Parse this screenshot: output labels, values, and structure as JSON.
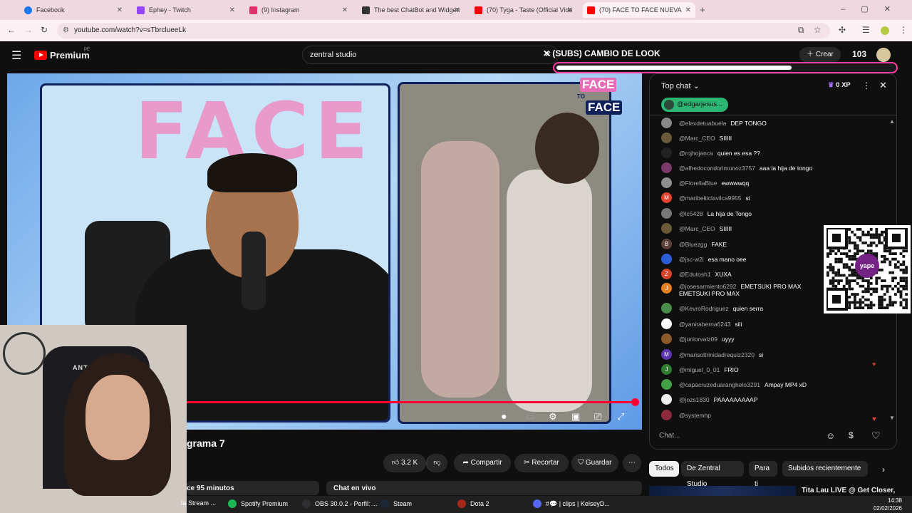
{
  "browser": {
    "tabs": [
      {
        "title": "Facebook",
        "color": "#1877f2"
      },
      {
        "title": "Ephey - Twitch",
        "color": "#9146ff"
      },
      {
        "title": "(9) Instagram",
        "color": "#e1306c"
      },
      {
        "title": "The best ChatBot and Widgets",
        "color": "#333333"
      },
      {
        "title": "(70) Tyga - Taste (Official Video)",
        "color": "#ff0000"
      },
      {
        "title": "(70) FACE TO FACE NUEVA",
        "color": "#ff0000"
      }
    ],
    "url": "youtube.com/watch?v=sTbrclueeLk"
  },
  "youtube": {
    "logo_text": "Premium",
    "logo_region": "PE",
    "search_value": "zentral studio",
    "create_label": "Crear",
    "notifications_count": "103"
  },
  "overlay": {
    "subs_title": "(SUBS) CAMBIO DE LOOK",
    "subs_progress": 0.69
  },
  "video": {
    "watermark_text": "FACE",
    "logo_top": "FACE",
    "logo_to": "TO",
    "logo_bottom": "FACE",
    "progress": 1.0,
    "title_partial": "grama 7",
    "webcam_brand": "ANTRYX"
  },
  "actions": {
    "likes": "3.2 K",
    "share": "Compartir",
    "clip": "Recortar",
    "save": "Guardar"
  },
  "below": {
    "desc_partial": "ce 95 minutos",
    "livechat_label": "Chat en vivo"
  },
  "chat": {
    "header": "Top chat",
    "xp": "0 XP",
    "pinned_user": "@edgarjesus...",
    "input_placeholder": "Chat...",
    "messages": [
      {
        "author": "@elexdetuabuela",
        "text": "DEP TONGO",
        "avatar": "#888888",
        "initial": ""
      },
      {
        "author": "@Marc_CEO",
        "text": "SIIIII",
        "avatar": "#6b5a3a",
        "initial": ""
      },
      {
        "author": "@rojhojanca",
        "text": "quien es esa ??",
        "avatar": "#222222",
        "initial": ""
      },
      {
        "author": "@alfredocondorimunoz3757",
        "text": "aaa la hija de tongo",
        "avatar": "#7a3a6a",
        "initial": ""
      },
      {
        "author": "@FiorellaBlue",
        "text": "ewwwwqq",
        "avatar": "#8e8e8e",
        "initial": ""
      },
      {
        "author": "@maribelticlavilca9955",
        "text": "si",
        "avatar": "#e0442c",
        "initial": "M"
      },
      {
        "author": "@lc5428",
        "text": "La hija de Tongo",
        "avatar": "#777777",
        "initial": ""
      },
      {
        "author": "@Marc_CEO",
        "text": "SIIIII",
        "avatar": "#6b5a3a",
        "initial": ""
      },
      {
        "author": "@Bluezgg",
        "text": "FAKE",
        "avatar": "#5d4037",
        "initial": "B"
      },
      {
        "author": "@jsc-w2i",
        "text": "esa mano oee",
        "avatar": "#2c5dd6",
        "initial": ""
      },
      {
        "author": "@Edutosh1",
        "text": "XUXA",
        "avatar": "#d8432c",
        "initial": "Z"
      },
      {
        "author": "@josesarmiento6292",
        "text": "EMETSUKI PRO MAX EMETSUKI PRO MAX",
        "avatar": "#e67e22",
        "initial": "J"
      },
      {
        "author": "@KevroRodriguez",
        "text": "quien serra",
        "avatar": "#4c8c4a",
        "initial": ""
      },
      {
        "author": "@yaniraberna6243",
        "text": "siii",
        "avatar": "#ffffff",
        "initial": ""
      },
      {
        "author": "@juniorvalz09",
        "text": "uyyy",
        "avatar": "#8b5a2b",
        "initial": ""
      },
      {
        "author": "@marisoltrinidadrequiz2320",
        "text": "si",
        "avatar": "#5e35b1",
        "initial": "M"
      },
      {
        "author": "@miguel_0_01",
        "text": "FRIO",
        "avatar": "#2e7d32",
        "initial": "J"
      },
      {
        "author": "@capacruzeduaranghelo3291",
        "text": "Ampay MP4 xD",
        "avatar": "#43a047",
        "initial": ""
      },
      {
        "author": "@jozs1830",
        "text": "PAAAAAAAAAP",
        "avatar": "#eeeeee",
        "initial": ""
      },
      {
        "author": "@systemhp",
        "text": "",
        "avatar": "#8a2a3a",
        "initial": ""
      }
    ]
  },
  "chips": [
    "Todos",
    "De Zentral Studio",
    "Para ti",
    "Subidos recientemente"
  ],
  "recommended": {
    "title": "Tita Lau LIVE @ Get Closer,"
  },
  "qr": {
    "label": "yape"
  },
  "taskbar": {
    "items": [
      {
        "label": "ta Stream ...",
        "color": "#888888"
      },
      {
        "label": "Spotify Premium",
        "color": "#1db954"
      },
      {
        "label": "OBS 30.0.2 - Perfil: ...",
        "color": "#302e31"
      },
      {
        "label": "Steam",
        "color": "#1b2838"
      },
      {
        "label": "Dota 2",
        "color": "#a8271c"
      },
      {
        "label": "#💬 | clips | KelseyD...",
        "color": "#5865f2"
      }
    ],
    "time": "14:38",
    "date": "02/02/2026"
  },
  "colors": {
    "accent": "#ff0033",
    "chat_green": "#2bb673",
    "subs_border": "#ff3ea5"
  }
}
